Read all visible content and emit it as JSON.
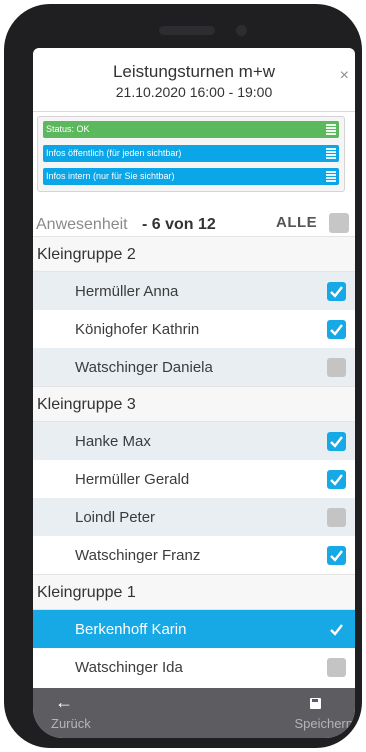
{
  "header": {
    "title": "Leistungsturnen m+w",
    "subtitle": "21.10.2020 16:00 - 19:00",
    "close_label": "×"
  },
  "info_bars": {
    "status_prefix": "Status: ",
    "status_value": "OK",
    "public_info": "Infos öffentlich (für jeden sichtbar)",
    "internal_info": "Infos intern (nur für Sie sichtbar)"
  },
  "attendance": {
    "label": "Anwesenheit",
    "count": "- 6 von 12",
    "all_label": "ALLE"
  },
  "groups": [
    {
      "name": "Kleingruppe 2",
      "members": [
        {
          "name": "Hermüller Anna",
          "checked": true
        },
        {
          "name": "Könighofer Kathrin",
          "checked": true
        },
        {
          "name": "Watschinger Daniela",
          "checked": false
        }
      ]
    },
    {
      "name": "Kleingruppe 3",
      "members": [
        {
          "name": "Hanke Max",
          "checked": true
        },
        {
          "name": "Hermüller Gerald",
          "checked": true
        },
        {
          "name": "Loindl Peter",
          "checked": false
        },
        {
          "name": "Watschinger Franz",
          "checked": true
        }
      ]
    },
    {
      "name": "Kleingruppe 1",
      "members": [
        {
          "name": "Berkenhoff Karin",
          "checked": true,
          "selected": true
        },
        {
          "name": "Watschinger Ida",
          "checked": false
        }
      ]
    }
  ],
  "footer": {
    "back_icon": "arrow-left-icon",
    "back_label": "Zurück",
    "save_icon": "floppy-disk-icon",
    "save_label": "Speichern"
  },
  "colors": {
    "accent": "#17a8e6",
    "status_ok": "#5cb85c",
    "footer": "#5c5c61"
  }
}
